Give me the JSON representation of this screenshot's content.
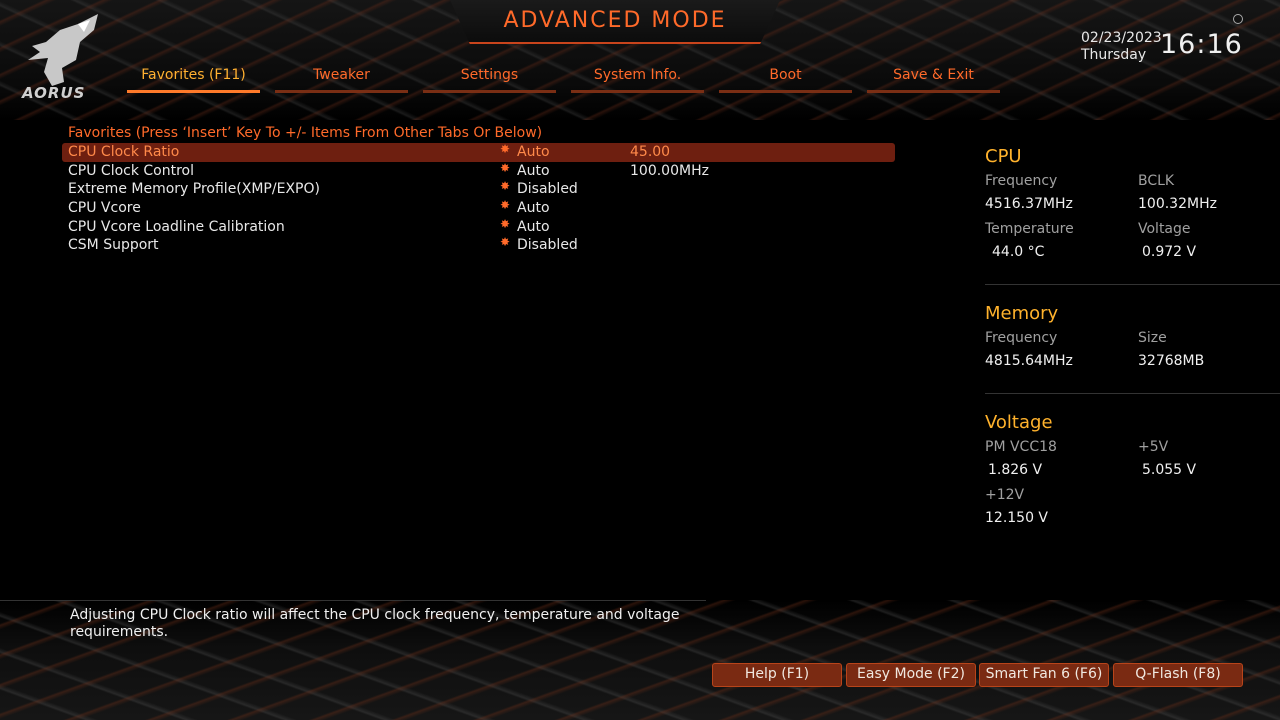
{
  "header": {
    "mode_title": "ADVANCED MODE",
    "logo_text": "AORUS",
    "date": "02/23/2023",
    "day": "Thursday",
    "time": "16:16"
  },
  "tabs": [
    {
      "label": "Favorites (F11)",
      "active": true
    },
    {
      "label": "Tweaker",
      "active": false
    },
    {
      "label": "Settings",
      "active": false
    },
    {
      "label": "System Info.",
      "active": false
    },
    {
      "label": "Boot",
      "active": false
    },
    {
      "label": "Save & Exit",
      "active": false
    }
  ],
  "favorites": {
    "header": "Favorites (Press ‘Insert’ Key To +/- Items From Other Tabs Or Below)",
    "items": [
      {
        "label": "CPU Clock Ratio",
        "value": "Auto",
        "extra": "45.00"
      },
      {
        "label": "CPU Clock Control",
        "value": "Auto",
        "extra": "100.00MHz"
      },
      {
        "label": "Extreme Memory Profile(XMP/EXPO)",
        "value": "Disabled",
        "extra": ""
      },
      {
        "label": "CPU Vcore",
        "value": "Auto",
        "extra": ""
      },
      {
        "label": "CPU Vcore Loadline Calibration",
        "value": "Auto",
        "extra": ""
      },
      {
        "label": "CSM Support",
        "value": "Disabled",
        "extra": ""
      }
    ]
  },
  "cpu": {
    "title": "CPU",
    "frequency_label": "Frequency",
    "frequency": "4516.37MHz",
    "bclk_label": "BCLK",
    "bclk": "100.32MHz",
    "temperature_label": "Temperature",
    "temperature": "44.0 °C",
    "voltage_label": "Voltage",
    "voltage": "0.972 V"
  },
  "memory": {
    "title": "Memory",
    "frequency_label": "Frequency",
    "frequency": "4815.64MHz",
    "size_label": "Size",
    "size": "32768MB"
  },
  "voltage": {
    "title": "Voltage",
    "pm_label": "PM VCC18",
    "pm": "1.826 V",
    "p5_label": "+5V",
    "p5": "5.055 V",
    "p12_label": "+12V",
    "p12": "12.150 V"
  },
  "help_text": "Adjusting CPU Clock ratio will affect the CPU clock frequency, temperature and voltage requirements.",
  "buttons": {
    "help": "Help (F1)",
    "easy": "Easy Mode (F2)",
    "smartfan": "Smart Fan 6 (F6)",
    "qflash": "Q-Flash (F8)"
  },
  "colors": {
    "accent": "#ff6a2a",
    "section_title": "#ffb22c",
    "selected_row": "#6e1f10"
  }
}
